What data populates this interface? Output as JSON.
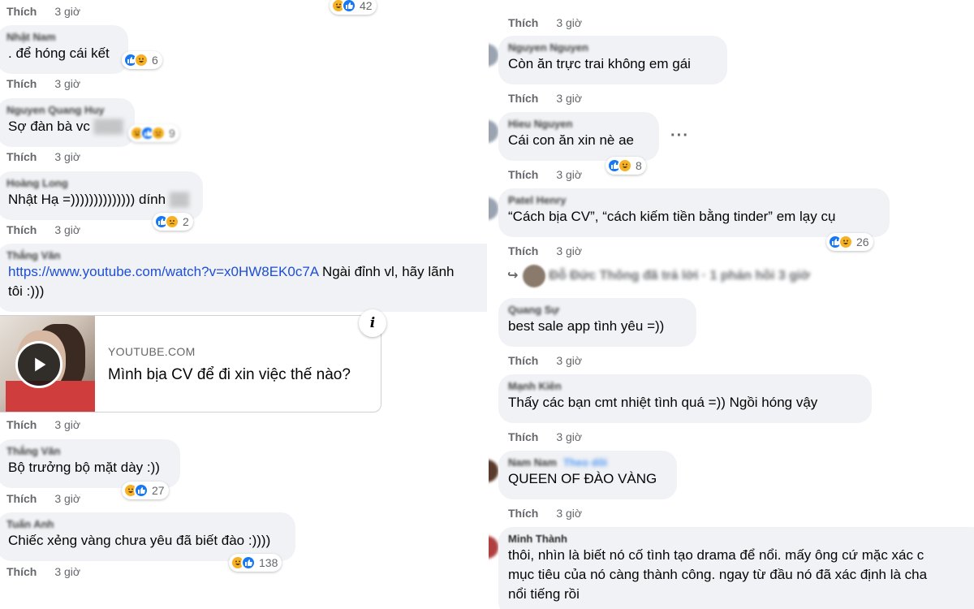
{
  "like_label": "Thích",
  "time_label": "3 giờ",
  "left": {
    "top_react_count": "42",
    "comments": [
      {
        "name": "Nhật Nam",
        "text": ". để hóng cái kết",
        "react_count": "6"
      },
      {
        "name": "Nguyen Quang Huy",
        "text": "Sợ đàn bà vc",
        "react_count": "9"
      },
      {
        "name": "Hoàng Long",
        "text": "Nhật Hạ =)))))))))))))) dính",
        "react_count": "2"
      },
      {
        "name": "Thắng Văn",
        "link": "https://www.youtube.com/watch?v=x0HW8EK0c7A",
        "text_after": " Ngài đỉnh vl, hãy lãnh",
        "text_line2": "tôi :)))"
      },
      {
        "name": "Thắng Văn",
        "text": "Bộ trưởng bộ mặt dày :))",
        "react_count": "27"
      },
      {
        "name": "Tuấn Anh",
        "text": "Chiếc xẻng vàng chưa yêu đã biết đào :))))",
        "react_count": "138"
      }
    ],
    "link_card": {
      "domain": "YOUTUBE.COM",
      "title": "Mình bịa CV để đi xin việc thế nào?",
      "info_symbol": "i"
    }
  },
  "right": {
    "comments": [
      {
        "name": "Nguyen Nguyen",
        "text": "Còn ăn trực trai không em gái"
      },
      {
        "name": "Hieu Nguyen",
        "text": "Cái con ăn xin nè ae",
        "react_count": "8"
      },
      {
        "name": "Patel Henry",
        "text": "“Cách bịa CV”, “cách kiếm tiền bằng tinder” em lạy cụ",
        "react_count": "26"
      },
      {
        "name": "Quang Sự",
        "text": "best sale app tình yêu =))"
      },
      {
        "name": "Mạnh Kiên",
        "text": "Thấy các bạn cmt nhiệt tình quá =)) Ngồi hóng vậy"
      },
      {
        "name": "Nam Nam",
        "follow": "Theo dõi",
        "text": "QUEEN OF ĐÀO VÀNG"
      },
      {
        "name": "Minh Thành",
        "text": "thôi, nhìn là biết nó cố tình tạo drama để nổi. mấy ông cứ mặc xác c",
        "text_line2": "mục tiêu của nó càng thành công. ngay từ đầu nó đã xác định là cha",
        "text_line3": "nổi tiếng rồi"
      }
    ],
    "reply_line": "Đỗ Đức Thông đã trả lời · 1 phản hồi 3 giờ",
    "more_symbol": "···"
  }
}
